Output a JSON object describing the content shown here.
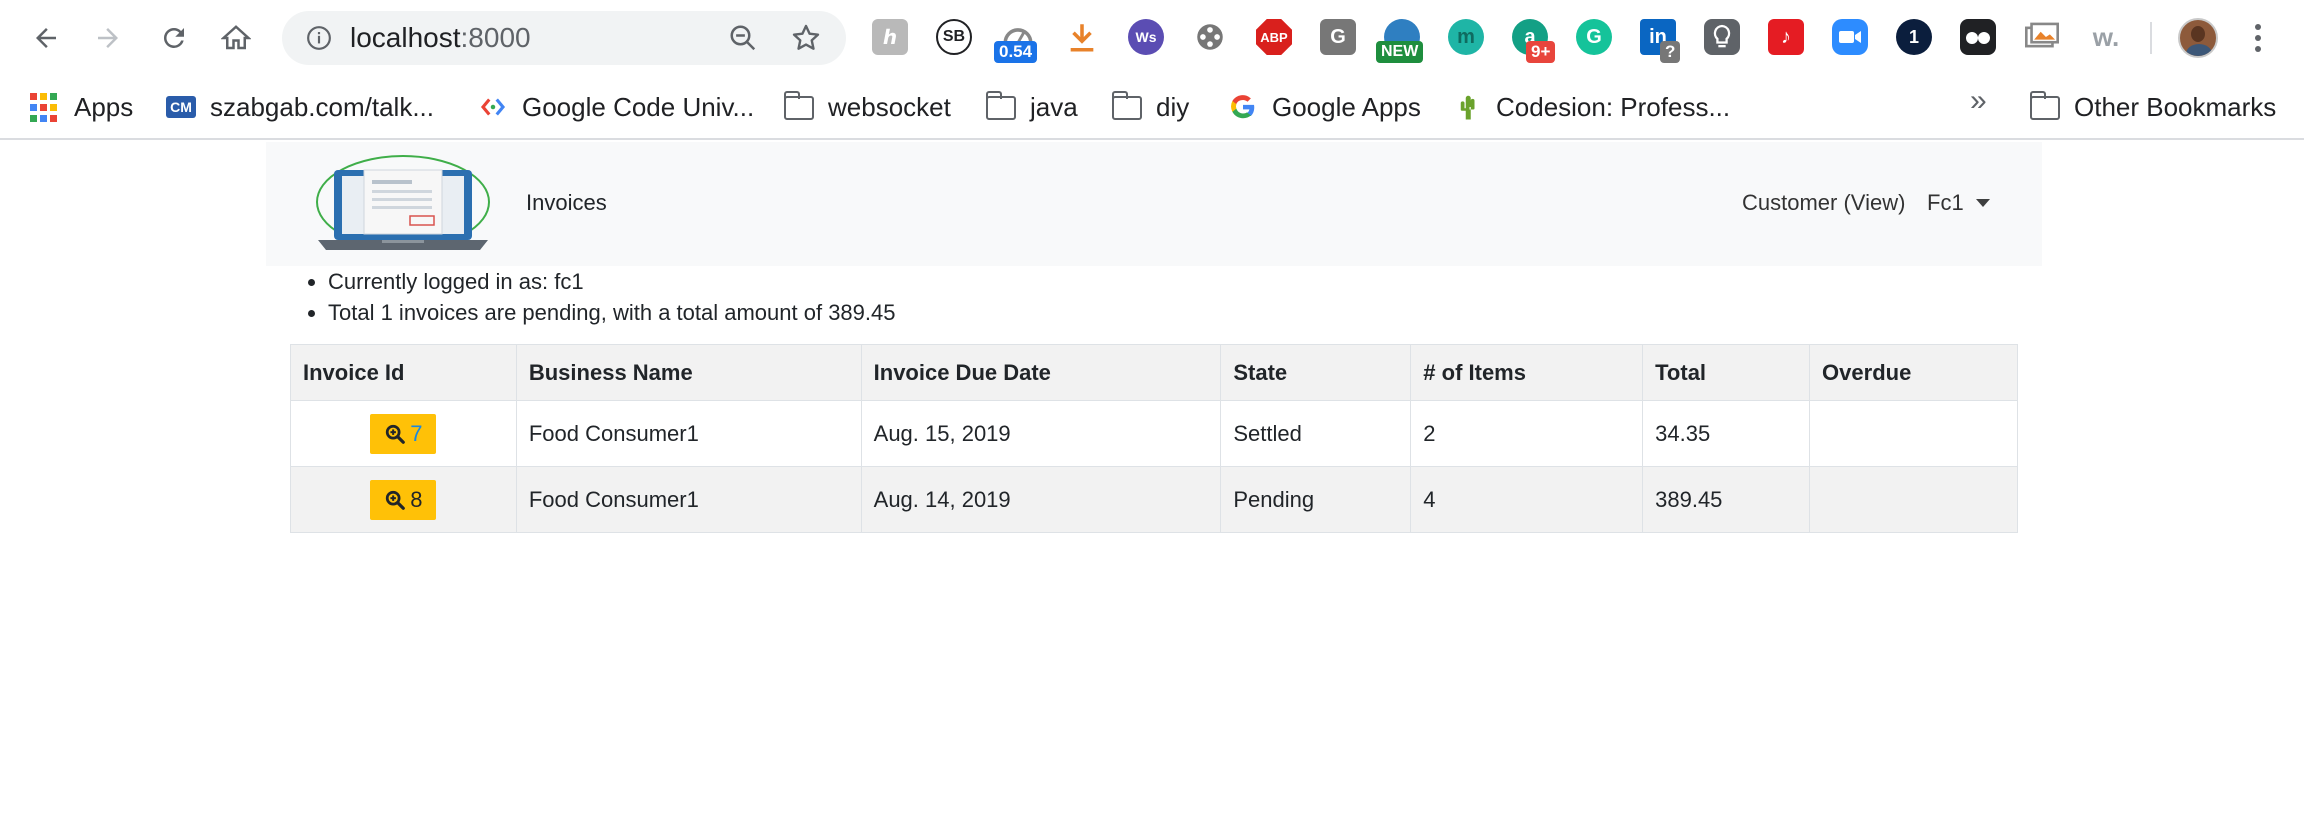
{
  "browser": {
    "url_host": "localhost",
    "url_port": ":8000",
    "extensions": [
      {
        "name": "honey-extension-icon",
        "glyph": "ℎ",
        "color": "#b9b9b9"
      },
      {
        "name": "sb-extension-icon",
        "glyph": "SB",
        "color": "#ffffff"
      },
      {
        "name": "speed-extension-icon",
        "badge": "0.54",
        "badge_color": "#1a73e8"
      },
      {
        "name": "download-extension-icon",
        "color": "#e8822a"
      },
      {
        "name": "wordspace-extension-icon",
        "glyph": "Ws",
        "color": "#5b4db3"
      },
      {
        "name": "film-extension-icon",
        "color": "#777777"
      },
      {
        "name": "adblock-extension-icon",
        "glyph": "ABP",
        "color": "#d9201d"
      },
      {
        "name": "g-extension-icon",
        "glyph": "G",
        "color": "#777777"
      },
      {
        "name": "globe-extension-icon",
        "badge": "NEW",
        "badge_color": "#1e8e3e"
      },
      {
        "name": "m-extension-icon",
        "glyph": "m",
        "color": "#1fb5a6"
      },
      {
        "name": "a-extension-icon",
        "glyph": "a",
        "color": "#13a085",
        "badge": "9+",
        "badge_color": "#e8453c"
      },
      {
        "name": "grammarly-extension-icon",
        "glyph": "G",
        "color": "#15c39a"
      },
      {
        "name": "linkedin-extension-icon",
        "glyph": "in",
        "color": "#0a66c2",
        "badge": "?",
        "badge_color": "#777777"
      },
      {
        "name": "bulb-extension-icon",
        "color": "#5f6368"
      },
      {
        "name": "music-extension-icon",
        "glyph": "♪",
        "color": "#e51c23"
      },
      {
        "name": "zoom-extension-icon",
        "color": "#2d8cff"
      },
      {
        "name": "onepassword-extension-icon",
        "glyph": "1",
        "color": "#0b1e3d"
      },
      {
        "name": "tab-extension-icon",
        "color": "#202124"
      },
      {
        "name": "screenshot-extension-icon",
        "color": "#888888"
      },
      {
        "name": "w-extension-icon",
        "glyph": "w.",
        "color": "#9aa0a6"
      }
    ]
  },
  "bookmarks": [
    {
      "label": "Apps"
    },
    {
      "label": "szabgab.com/talk..."
    },
    {
      "label": "Google Code Univ..."
    },
    {
      "label": "websocket"
    },
    {
      "label": "java"
    },
    {
      "label": "diy"
    },
    {
      "label": "Google Apps"
    },
    {
      "label": "Codesion: Profess..."
    },
    {
      "label": "Other Bookmarks"
    }
  ],
  "bookmarks_overflow": "»",
  "navbar": {
    "brand": "Invoices",
    "customer_link": "Customer (View)",
    "user_menu": "Fc1"
  },
  "info": [
    "Currently logged in as: fc1",
    "Total 1 invoices are pending, with a total amount of 389.45"
  ],
  "table": {
    "headers": [
      "Invoice Id",
      "Business Name",
      "Invoice Due Date",
      "State",
      "# of Items",
      "Total",
      "Overdue"
    ],
    "rows": [
      {
        "id": "7",
        "business": "Food Consumer1",
        "due": "Aug. 15, 2019",
        "state": "Settled",
        "items": "2",
        "total": "34.35",
        "overdue": ""
      },
      {
        "id": "8",
        "business": "Food Consumer1",
        "due": "Aug. 14, 2019",
        "state": "Pending",
        "items": "4",
        "total": "389.45",
        "overdue": ""
      }
    ]
  },
  "colors": {
    "accent_button": "#ffc107",
    "navbar_bg": "#f8f9fa",
    "link": "#1a88e0"
  }
}
